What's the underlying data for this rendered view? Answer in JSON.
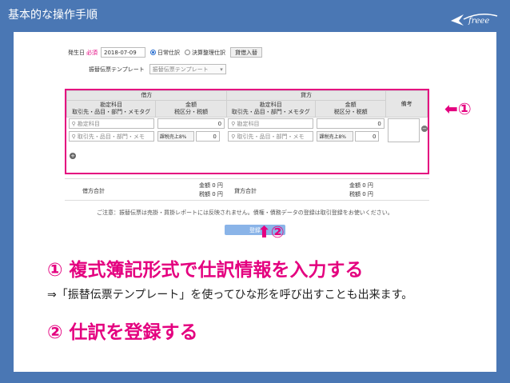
{
  "slide": {
    "title": "基本的な操作手順"
  },
  "form": {
    "date_label": "発生日",
    "required_mark": "必須",
    "date_value": "2018-07-09",
    "radio_normal": "日常仕訳",
    "radio_closing": "決算整理仕訳",
    "tag_button": "貸借入替",
    "template_label": "振替伝票テンプレート",
    "template_placeholder": "振替伝票テンプレート",
    "debit_header": "借方",
    "credit_header": "貸方",
    "account_header": "勘定科目",
    "partner_header": "取引先・品目・部門・メモタグ",
    "amount_header": "金額",
    "tax_header": "税区分・税額",
    "memo_header": "備考",
    "account_placeholder": "勘定科目",
    "partner_placeholder": "取引先・品目・部門・メモ",
    "amount_value": "0",
    "tax_value": "課税売上8%",
    "debit_total_label": "借方合計",
    "credit_total_label": "貸方合計",
    "amount_total": "金額 0 円",
    "tax_total": "税額 0 円",
    "notice": "ご注意：振替伝票は売掛・買掛レポートには反映されません。債権・債務データの登録は取引登録をお使いください。",
    "register_button": "登録"
  },
  "callouts": {
    "one": "① ",
    "two": "②"
  },
  "content": {
    "heading1": "① 複式簿記形式で仕訳情報を入力する",
    "body1": "⇒「振替伝票テンプレート」を使ってひな形を呼び出すことも出来ます。",
    "heading2": "② 仕訳を登録する"
  },
  "colors": {
    "background": "#4a77b4",
    "accent": "#e4007f",
    "button": "#8ab4e8"
  }
}
